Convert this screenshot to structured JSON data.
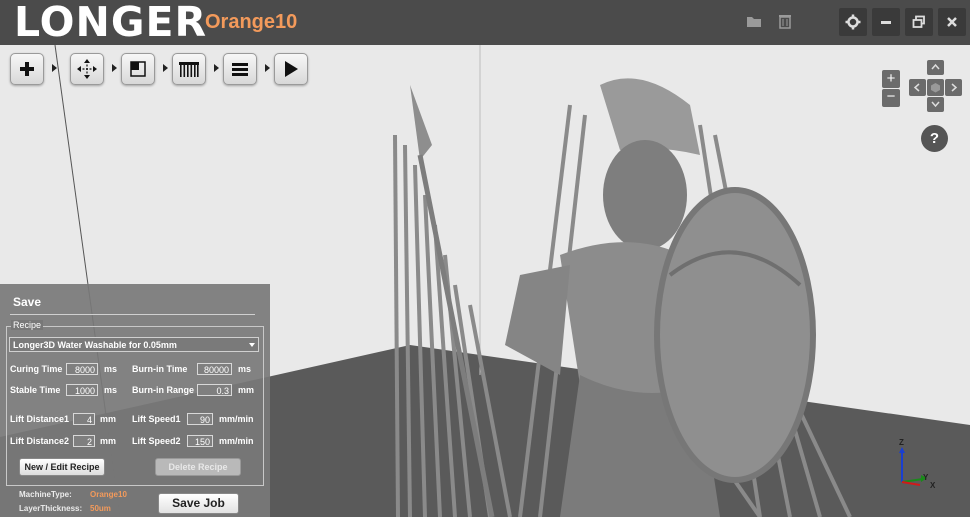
{
  "header": {
    "logo": "LONGER",
    "model": "Orange10",
    "icons": [
      "folder-icon",
      "trash-icon"
    ],
    "window_buttons": [
      "gear-icon",
      "minimize-icon",
      "restore-icon",
      "close-icon"
    ]
  },
  "toolbar": {
    "tools": [
      "add-icon",
      "move-icon",
      "scale-icon",
      "supports-icon",
      "slice-layers-icon",
      "play-icon"
    ]
  },
  "navigation": {
    "zoom_in": "+",
    "zoom_out": "−",
    "help": "?"
  },
  "save_panel": {
    "title": "Save",
    "recipe_legend": "Recipe",
    "recipe_selected": "Longer3D Water Washable for 0.05mm",
    "fields": {
      "curing_time": {
        "label": "Curing Time",
        "value": "8000",
        "unit": "ms"
      },
      "burnin_time": {
        "label": "Burn-in Time",
        "value": "80000",
        "unit": "ms"
      },
      "stable_time": {
        "label": "Stable Time",
        "value": "1000",
        "unit": "ms"
      },
      "burnin_range": {
        "label": "Burn-in Range",
        "value": "0.3",
        "unit": "mm"
      },
      "lift_distance1": {
        "label": "Lift Distance1",
        "value": "4",
        "unit": "mm"
      },
      "lift_speed1": {
        "label": "Lift Speed1",
        "value": "90",
        "unit": "mm/min"
      },
      "lift_distance2": {
        "label": "Lift Distance2",
        "value": "2",
        "unit": "mm"
      },
      "lift_speed2": {
        "label": "Lift Speed2",
        "value": "150",
        "unit": "mm/min"
      }
    },
    "new_edit_button": "New / Edit Recipe",
    "delete_button": "Delete Recipe",
    "machine_type_label": "MachineType:",
    "machine_type_value": "Orange10",
    "layer_thickness_label": "LayerThickness:",
    "layer_thickness_value": "50um",
    "save_job_button": "Save Job"
  },
  "axes": {
    "z": "Z",
    "y": "Y",
    "x": "X"
  },
  "colors": {
    "accent": "#f39a5b",
    "titlebar": "#4b4b4b",
    "model": "#8e8e8e"
  }
}
